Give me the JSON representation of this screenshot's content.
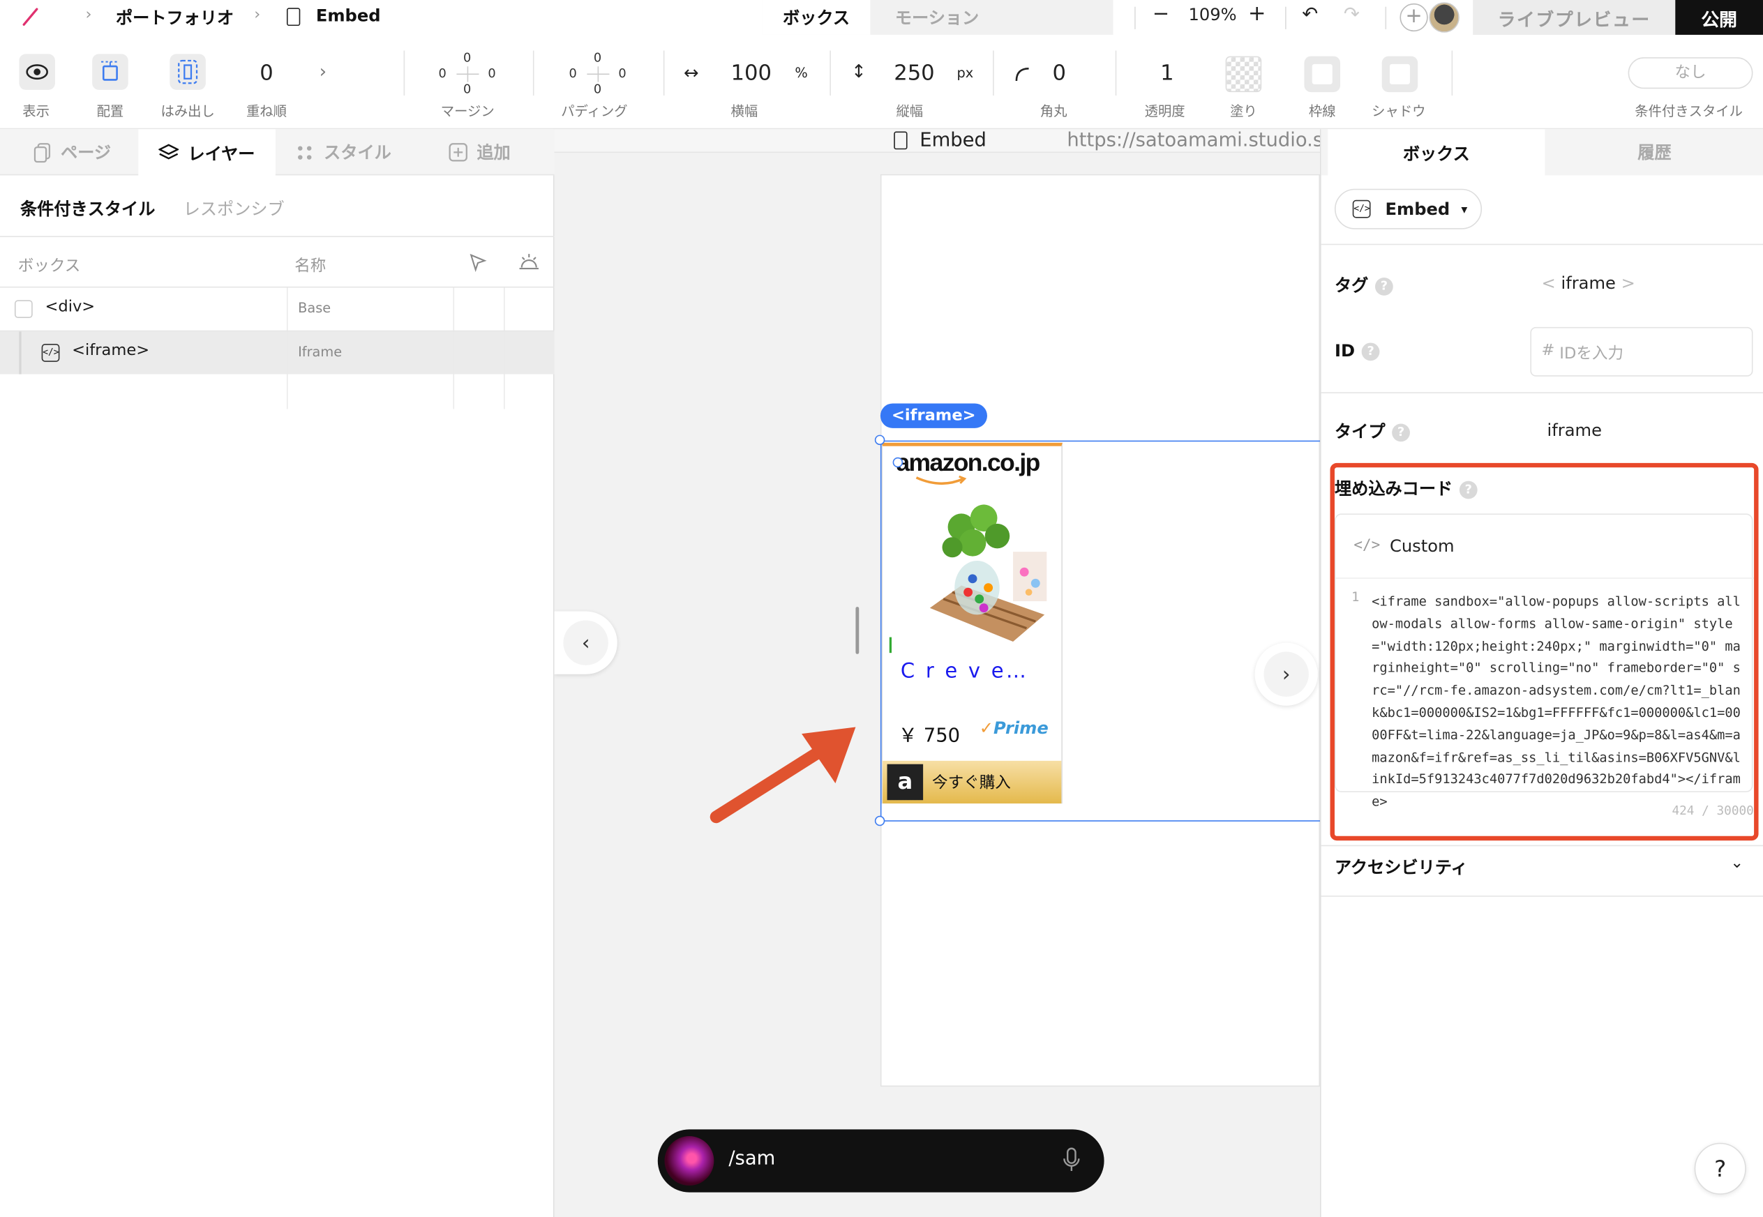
{
  "topbar": {
    "breadcrumb": [
      "ポートフォリオ",
      "Embed"
    ],
    "mode_tabs": [
      "ボックス",
      "モーション"
    ],
    "zoom": "109%",
    "live_preview": "ライブプレビュー",
    "publish": "公開"
  },
  "toolbar": {
    "display_label": "表示",
    "layout_label": "配置",
    "overflow_label": "はみ出し",
    "zindex_value": "0",
    "zindex_label": "重ね順",
    "margin_label": "マージン",
    "margin_values": [
      "0",
      "0",
      "0",
      "0"
    ],
    "padding_label": "パディング",
    "padding_values": [
      "0",
      "0",
      "0",
      "0"
    ],
    "width_value": "100",
    "width_unit": "%",
    "width_label": "横幅",
    "height_value": "250",
    "height_unit": "px",
    "height_label": "縦幅",
    "radius_value": "0",
    "radius_label": "角丸",
    "opacity_value": "1",
    "opacity_label": "透明度",
    "fill_label": "塗り",
    "border_label": "枠線",
    "shadow_label": "シャドウ",
    "conditional_value": "なし",
    "conditional_label": "条件付きスタイル"
  },
  "left_panel": {
    "tabs": [
      "ページ",
      "レイヤー",
      "スタイル",
      "追加"
    ],
    "subtabs": [
      "条件付きスタイル",
      "レスポンシブ"
    ],
    "col_box": "ボックス",
    "col_name": "名称",
    "rows": [
      {
        "tag": "<div>",
        "name": "Base"
      },
      {
        "tag": "<iframe>",
        "name": "Iframe"
      }
    ]
  },
  "canvas": {
    "tab_title": "Embed",
    "url": "https://satoamami.studio.si",
    "selection_tag": "<iframe>",
    "ad": {
      "brand": "amazon.co.jp",
      "title": "C r e v e…",
      "price": "￥ 750",
      "prime": "Prime",
      "buy": "今すぐ購入"
    },
    "command_text": "/sam"
  },
  "right_panel": {
    "tabs": [
      "ボックス",
      "履歴"
    ],
    "component": "Embed",
    "tag_label": "タグ",
    "tag_value": "iframe",
    "id_label": "ID",
    "id_placeholder": "IDを入力",
    "type_label": "タイプ",
    "type_value": "iframe",
    "embed_label": "埋め込みコード",
    "custom_label": "Custom",
    "line_number": "1",
    "code": "<iframe sandbox=\"allow-popups allow-scripts allow-modals allow-forms allow-same-origin\" style=\"width:120px;height:240px;\" marginwidth=\"0\" marginheight=\"0\" scrolling=\"no\" frameborder=\"0\" src=\"//rcm-fe.amazon-adsystem.com/e/cm?lt1=_blank&bc1=000000&IS2=1&bg1=FFFFFF&fc1=000000&lc1=0000FF&t=lima-22&language=ja_JP&o=9&p=8&l=as4&m=amazon&f=ifr&ref=as_ss_li_til&asins=B06XFV5GNV&linkId=5f913243c4077f7d020d9632b20fabd4\"></iframe>",
    "char_count": "424 / 30000",
    "accessibility_label": "アクセシビリティ"
  },
  "colors": {
    "accent_blue": "#3578f6",
    "highlight_red": "#e8482a",
    "publish_black": "#111111"
  }
}
